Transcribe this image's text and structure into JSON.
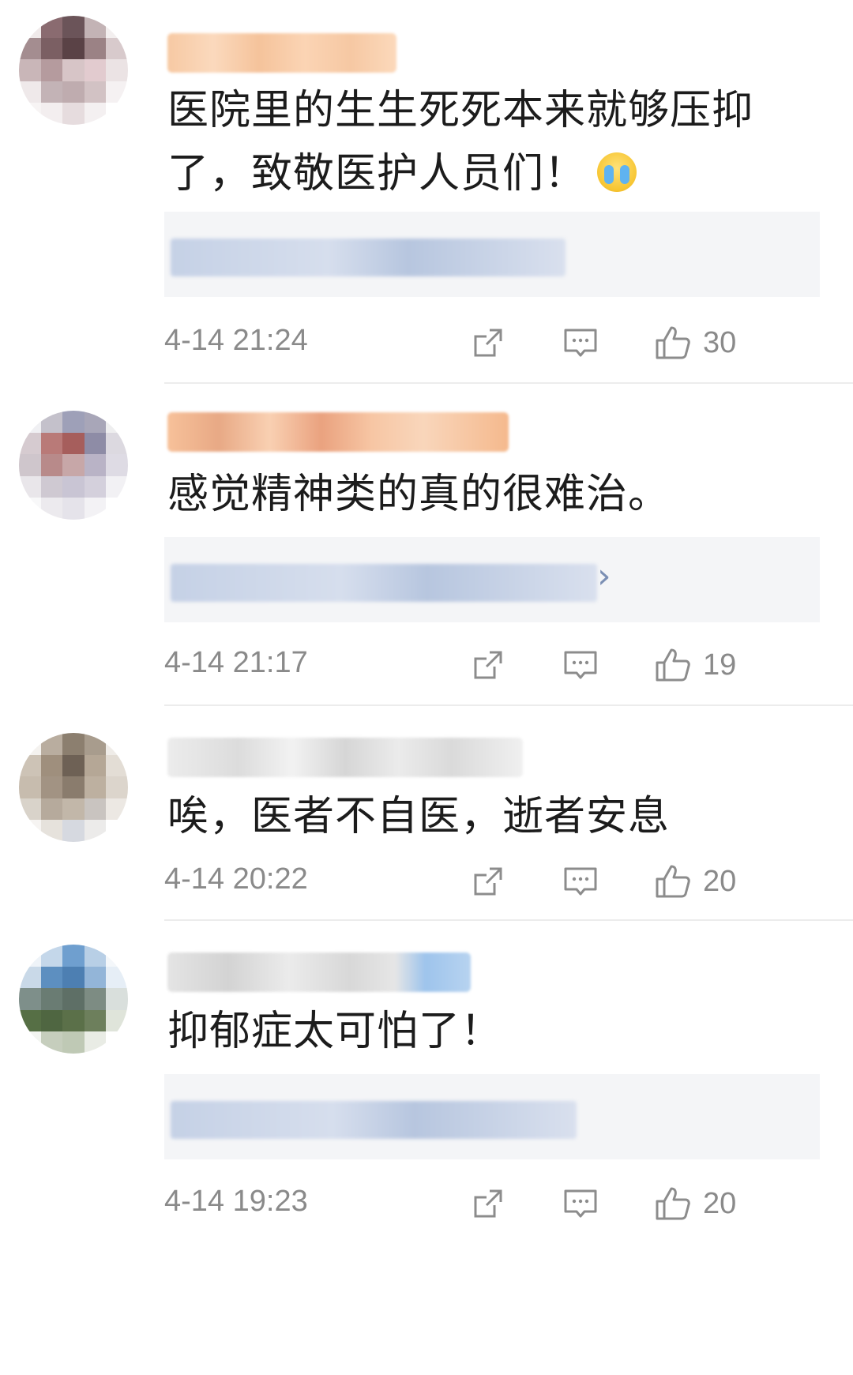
{
  "comments": [
    {
      "avatar_colors": [
        "#f0eaea",
        "#8a6b70",
        "#6b5459",
        "#c3b3b5",
        "#f3efef",
        "#a48d90",
        "#7b5f63",
        "#5a4246",
        "#9b8285",
        "#d8cacc",
        "#c9b6b8",
        "#b59b9e",
        "#d7c5c7",
        "#e2cbcf",
        "#ebe3e4",
        "#efe9ea",
        "#c3b3b6",
        "#bfacaf",
        "#d2c2c4",
        "#f5f1f2",
        "#f7f4f4",
        "#f3eeef",
        "#e6dcde",
        "#f4f0f1",
        "#ffffff"
      ],
      "username_gradient": "linear-gradient(90deg,#f7c9a3,#fbd9bd 20%,#f5c39b 40%,#fbd4b4 60%,#f6c8a3 80%,#fcd9bb)",
      "text": "医院里的生生死死本来就够压抑了，致敬医护人员们！",
      "emoji_icon": "crying-face-icon",
      "time": "4-14 21:24",
      "likes": "30"
    },
    {
      "avatar_colors": [
        "#f0f0f3",
        "#c4c1cb",
        "#9ea0b8",
        "#a8a6b8",
        "#eeeeef",
        "#d6cbd0",
        "#b97a78",
        "#a65e5c",
        "#8e8ca6",
        "#dcd9e0",
        "#cfc6cc",
        "#b88a8a",
        "#c7a7a8",
        "#b9b3c6",
        "#dedbe4",
        "#e9e6ea",
        "#cfc9d2",
        "#c9c5d4",
        "#d4d0dc",
        "#f2f1f4",
        "#f8f8f9",
        "#eceaee",
        "#e5e3ea",
        "#f3f2f5",
        "#ffffff"
      ],
      "username_gradient": "linear-gradient(90deg,#f7c19a,#e8a985 15%,#f9d0b2 30%,#eaa27f 45%,#f7c6a4 60%,#f9d6bb 75%,#f5b98d)",
      "text": "感觉精神类的真的很难治。",
      "time": "4-14 21:17",
      "likes": "19"
    },
    {
      "avatar_colors": [
        "#f4f2ef",
        "#b9ad9f",
        "#8c7f6f",
        "#a89c8d",
        "#efece8",
        "#cdc3b6",
        "#9f8f7d",
        "#6e6155",
        "#b5a796",
        "#e3ddd5",
        "#c7bcae",
        "#a29383",
        "#8a7c6d",
        "#bdb0a0",
        "#dcd5cc",
        "#d9d3ca",
        "#b6aa9c",
        "#c2b7a9",
        "#c9c4c0",
        "#ece8e3",
        "#f6f4f2",
        "#e6e2dc",
        "#d6d9e0",
        "#ecebea",
        "#ffffff"
      ],
      "username_gradient": "linear-gradient(90deg,#ececec,#dcdcdc 20%,#f2f2f2 35%,#d6d6d6 50%,#ebebeb 65%,#dadada 80%,#f0f0f0)",
      "text": "唉，医者不自医，逝者安息",
      "time": "4-14 20:22",
      "likes": "20"
    },
    {
      "avatar_colors": [
        "#eef3f8",
        "#c4d7ea",
        "#6f9fcf",
        "#b8cfe6",
        "#f4f7fa",
        "#c9d9e8",
        "#5d8fc0",
        "#4d7fb2",
        "#93b5d8",
        "#e6eef6",
        "#7e8f8a",
        "#6a7c73",
        "#5e6f66",
        "#7d8c83",
        "#d9dfdc",
        "#566f45",
        "#4f6641",
        "#5b7049",
        "#6d7f5c",
        "#dfe4da",
        "#f3f5f1",
        "#c6cebd",
        "#bfc9b5",
        "#e9ece5",
        "#ffffff"
      ],
      "username_gradient": "linear-gradient(90deg,#e4e4e4,#d3d3d3 20%,#ebebeb 40%,#d8d8d8 60%,#e6e6e6 75%,#9ec4ec 85%,#b7d3f0)",
      "text": "抑郁症太可怕了！",
      "time": "4-14 19:23",
      "likes": "20"
    }
  ],
  "icons": {
    "share": "share-icon",
    "comment": "comment-icon",
    "like": "like-icon",
    "reply_arrow": "›"
  }
}
